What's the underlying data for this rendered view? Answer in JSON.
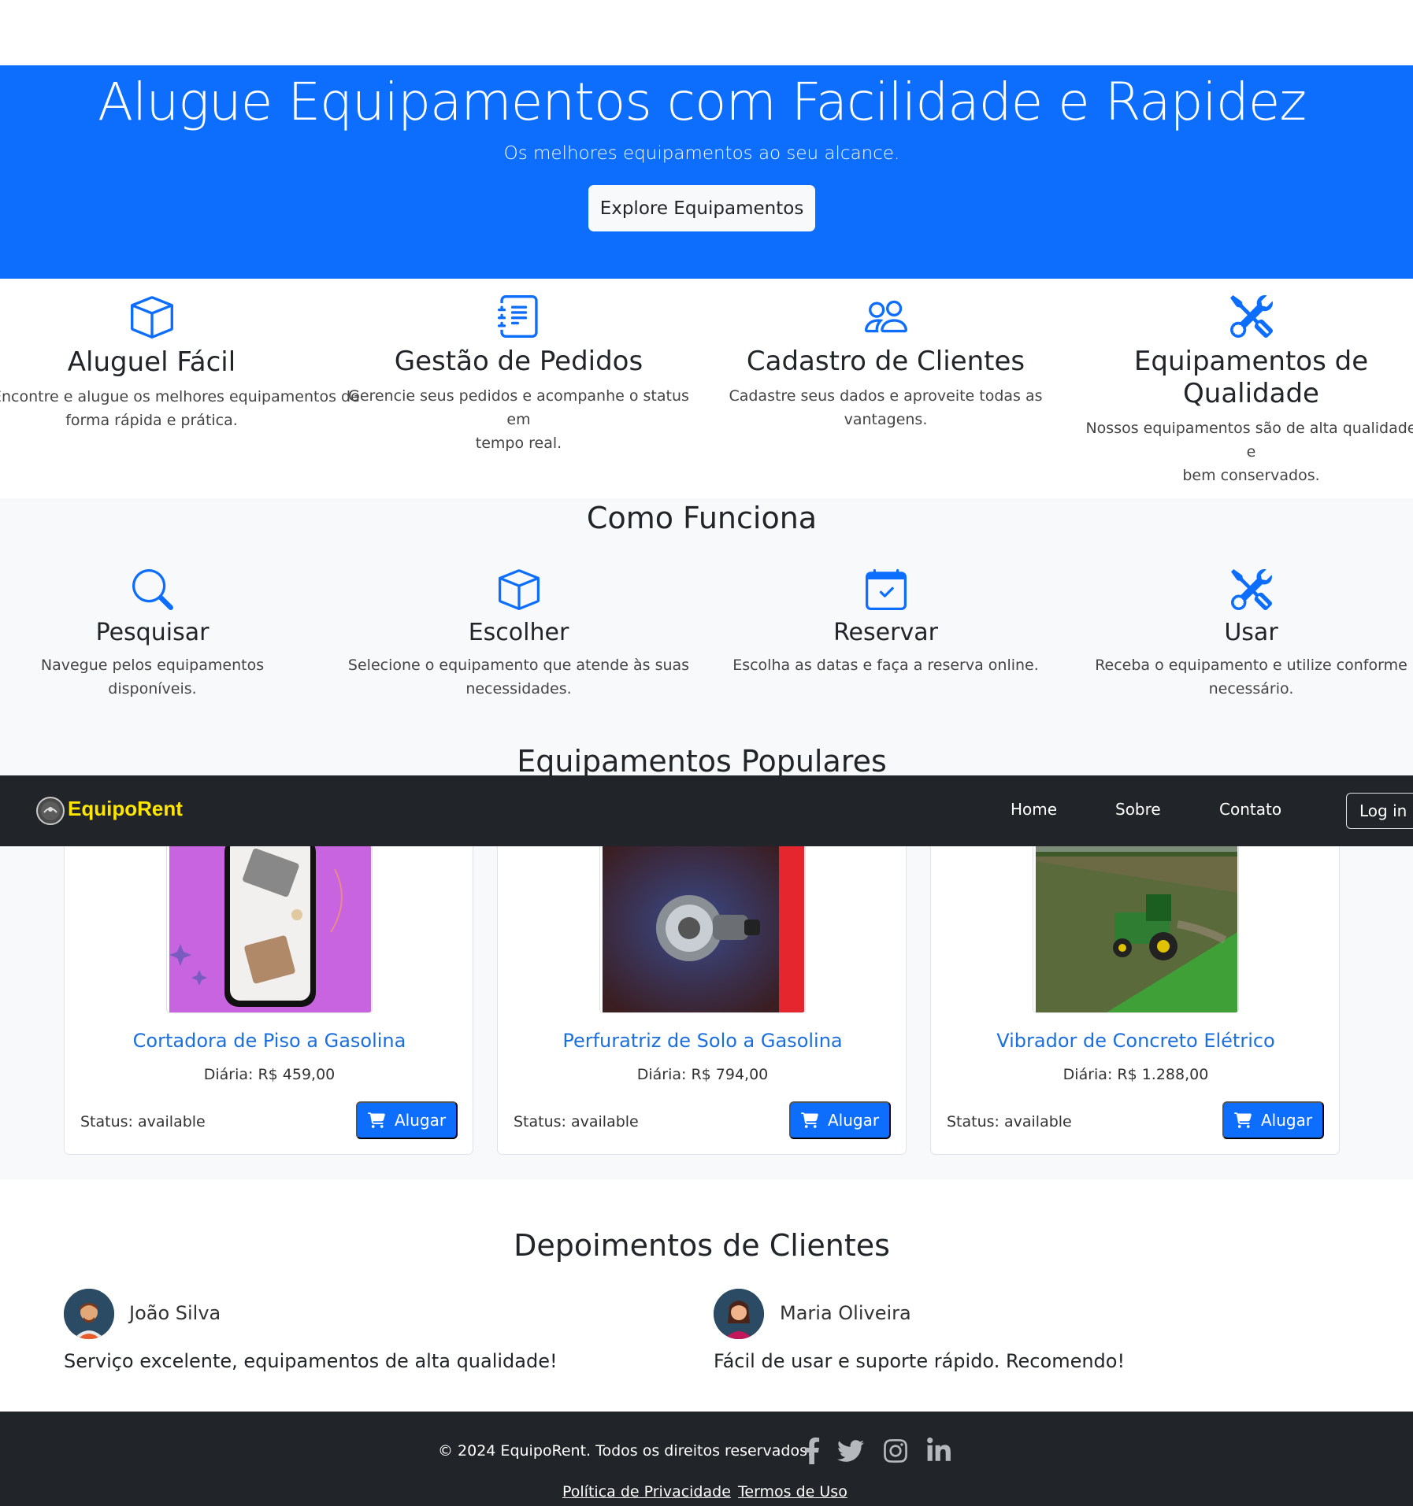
{
  "hero": {
    "title": "Alugue Equipamentos com Facilidade e Rapidez",
    "subtitle": "Os melhores equipamentos ao seu alcance.",
    "cta_label": "Explore Equipamentos"
  },
  "features": [
    {
      "icon": "box-icon",
      "title": "Aluguel Fácil",
      "text_l1": "Encontre e alugue os melhores equipamentos de",
      "text_l2": "forma rápida e prática."
    },
    {
      "icon": "journal-list-icon",
      "title": "Gestão de Pedidos",
      "text_l1": "Gerencie seus pedidos e acompanhe o status em",
      "text_l2": "tempo real."
    },
    {
      "icon": "people-icon",
      "title": "Cadastro de Clientes",
      "text_l1": "Cadastre seus dados e aproveite todas as",
      "text_l2": "vantagens."
    },
    {
      "icon": "tools-icon",
      "title_l1": "Equipamentos de",
      "title_l2": "Qualidade",
      "text_l1": "Nossos equipamentos são de alta qualidade e",
      "text_l2": "bem conservados."
    }
  ],
  "how": {
    "title": "Como Funciona",
    "steps": [
      {
        "icon": "search-icon",
        "title": "Pesquisar",
        "text_l1": "Navegue pelos equipamentos disponíveis.",
        "text_l2": ""
      },
      {
        "icon": "box-icon",
        "title": "Escolher",
        "text_l1": "Selecione o equipamento que atende às suas",
        "text_l2": "necessidades."
      },
      {
        "icon": "calendar-check-icon",
        "title": "Reservar",
        "text_l1": "Escolha as datas e faça a reserva online.",
        "text_l2": ""
      },
      {
        "icon": "tools-icon",
        "title": "Usar",
        "text_l1": "Receba o equipamento e utilize conforme",
        "text_l2": "necessário."
      }
    ]
  },
  "popular": {
    "title": "Equipamentos Populares",
    "cards": [
      {
        "name": "Cortadora de Piso a Gasolina",
        "price": "Diária: R$ 459,00",
        "status": "Status: available",
        "rent_label": "Alugar"
      },
      {
        "name": "Perfuratriz de Solo a Gasolina",
        "price": "Diária: R$ 794,00",
        "status": "Status: available",
        "rent_label": "Alugar"
      },
      {
        "name": "Vibrador de Concreto Elétrico",
        "price": "Diária: R$ 1.288,00",
        "status": "Status: available",
        "rent_label": "Alugar"
      }
    ]
  },
  "navbar": {
    "brand": "EquipoRent",
    "links": [
      "Home",
      "Sobre",
      "Contato"
    ],
    "login_label": "Log in"
  },
  "testimonials": {
    "title": "Depoimentos de Clientes",
    "items": [
      {
        "name": "João Silva",
        "quote": "Serviço excelente, equipamentos de alta qualidade!"
      },
      {
        "name": "Maria Oliveira",
        "quote": "Fácil de usar e suporte rápido. Recomendo!"
      }
    ]
  },
  "footer": {
    "copyright": "© 2024 EquipoRent. Todos os direitos reservados.",
    "social": [
      "facebook-icon",
      "twitter-icon",
      "instagram-icon",
      "linkedin-icon"
    ],
    "links": [
      "Política de Privacidade",
      "Termos de Uso"
    ]
  },
  "colors": {
    "primary": "#0d6efd",
    "dark": "#212529",
    "light": "#f8f9fa",
    "brand": "#ffe600",
    "link": "#1a6fdf"
  }
}
